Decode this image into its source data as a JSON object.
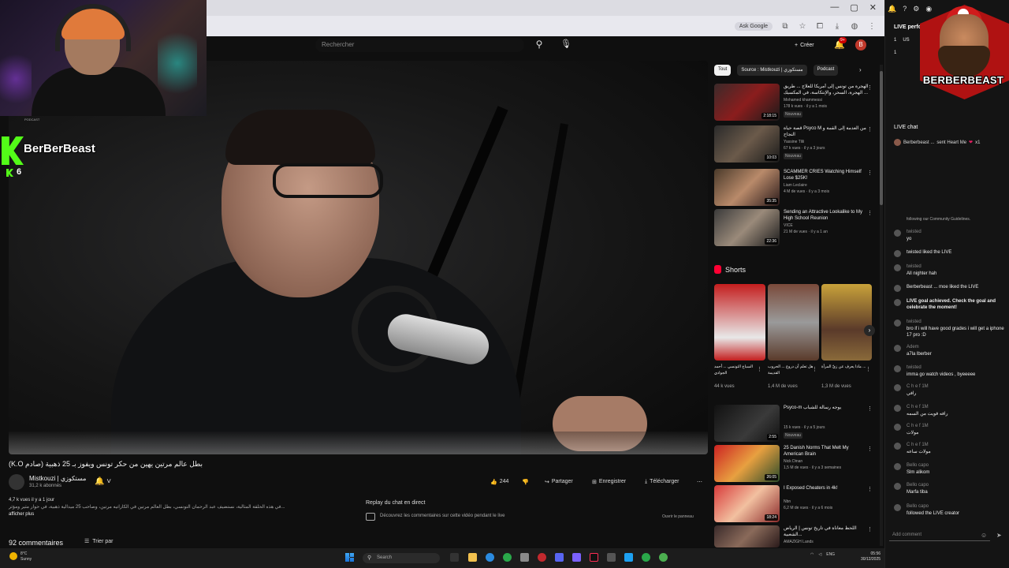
{
  "browser": {
    "ask_google": "Ask Google",
    "window_controls": [
      "—",
      "▢",
      "✕"
    ]
  },
  "yt_header": {
    "search_placeholder": "Rechercher",
    "create_label": "Créer",
    "notif_badge": "9+",
    "avatar_letter": "B"
  },
  "stream_overlay": {
    "tag": "PODCAST",
    "streamer": "BerBerBeast",
    "viewers": "6"
  },
  "video": {
    "title": "(K.O صادم) بطل عالم مرتين يهين من حكر تونس ويفوز بـ 25 ذهبية",
    "channel": "Mistkouzi | مستكوزي",
    "subscribers": "31,2 k abonnés",
    "likes": "244",
    "share": "Partager",
    "save": "Enregistrer",
    "download": "Télécharger",
    "description_meta": "4,7 k vues  il y a 1 jour",
    "description_line1": "في هذه الحلقة المثالية، نستضيف عبد الرحمان التونسي، بطل العالم مرتين في الكاراتيه مرتين، وصاحب 25 ميدالية ذهبية، في حوار مثير ومؤثر...",
    "show_more": "afficher plus",
    "chat_replay_title": "Replay du chat en direct",
    "chat_replay_text": "Découvrez les commentaires sur cette vidéo pendant le live",
    "chat_replay_open": "Ouvrir le panneau",
    "comments": "92 commentaires",
    "sort_by": "Trier par"
  },
  "filter_chips": [
    "Tout",
    "Source : Mistkouzi | مستكوزي",
    "Podcast"
  ],
  "recommendations": [
    {
      "title": "الهجرة من تونس إلى أمريكا للعلاج ... طريق الهجرة، السحر، والإنتكاسة، في المكسيك ...",
      "channel": "Mohamed khammessi",
      "views": "178 k vues · il y a 1 mois",
      "badge": "Nouveau",
      "duration": "2:18:15"
    },
    {
      "title": "قصة حياة Psyco M من العدمة إلى القمة و النجاح",
      "channel": "Yassine Tlili",
      "views": "67 k vues · il y a 3 jours",
      "badge": "Nouveau",
      "duration": "10:03"
    },
    {
      "title": "SCAMMER CRIES Watching Himself Lose $25K!",
      "channel": "Liam Leclaire",
      "views": "4 M de vues · il y a 3 mois",
      "badge": "",
      "duration": "35:35"
    },
    {
      "title": "Sending an Attractive Lookalike to My High School Reunion",
      "channel": "VICE",
      "views": "21 M de vues · il y a 1 an",
      "badge": "",
      "duration": "22:36"
    }
  ],
  "shorts": {
    "label": "Shorts",
    "items": [
      {
        "title": "السباح التونسي ... أحمد الجوادي",
        "views": "44 k vues"
      },
      {
        "title": "هل تعلم أن دروع ... الحروب القديمة",
        "views": "1,4 M de vues"
      },
      {
        "title": "ماذا يعرف عن زيّ المرأة ...",
        "views": "1,3 M de vues"
      }
    ]
  },
  "recommendations2": [
    {
      "title": "Psyco-m يوجه رسالة للشباب",
      "channel": "",
      "views": "15 k vues · il y a 5 jours",
      "badge": "Nouveau",
      "duration": "2:55"
    },
    {
      "title": "25 Danish Norms That Melt My American Brain",
      "channel": "Nick Dinan",
      "views": "1,5 M de vues · il y a 3 semaines",
      "badge": "",
      "duration": "26:05"
    },
    {
      "title": "I Exposed Cheaters in 4k!",
      "channel": "Nbn",
      "views": "6,2 M de vues · il y a 6 mois",
      "badge": "",
      "duration": "18:24"
    },
    {
      "title": "اللحظ معاناة في تاريخ تونس | الرياض الشعبية...",
      "channel": "AMAZIGH Lands",
      "views": "",
      "badge": "",
      "duration": ""
    }
  ],
  "taskbar": {
    "weather_temp": "8°C",
    "weather_desc": "Sunny",
    "search": "Search",
    "lang": "ENG",
    "time": "05:56",
    "date": "30/12/2025"
  },
  "live_panel": {
    "perf_title": "LIVE perform",
    "stat1": "1",
    "stat2": "US",
    "gift": "1",
    "overlay_name": "BERBERBEAST",
    "chat_title": "LIVE chat",
    "pinned_user": "Berberbeast ...",
    "pinned_text": "sent Heart Me",
    "pinned_count": "x1",
    "rules_tail": "following our Community Guidelines.",
    "input_placeholder": "Add comment"
  },
  "chat_messages": [
    {
      "user": "twisted",
      "text": "yo",
      "bold": false
    },
    {
      "user": "",
      "text": "twisted liked the LIVE",
      "bold": false,
      "inline": true
    },
    {
      "user": "twisted",
      "text": "All nighter hah",
      "bold": false
    },
    {
      "user": "",
      "text": "Berberbeast ... moe liked the LIVE",
      "bold": false,
      "inline": true
    },
    {
      "user": "",
      "text": "LIVE goal achieved. Check the goal and celebrate the moment!",
      "bold": true,
      "inline": true
    },
    {
      "user": "twisted",
      "text": "bro if i will have good grades i will get a iphone 17 pro :D",
      "bold": false
    },
    {
      "user": "Adem",
      "text": "a7la lberber",
      "bold": false
    },
    {
      "user": "twisted",
      "text": "imma go watch videos , byeeeee",
      "bold": false
    },
    {
      "user": "C h e f  1M",
      "text": "رافي",
      "bold": false
    },
    {
      "user": "C h e f  1M",
      "text": "رافه قويت من السمه",
      "bold": false
    },
    {
      "user": "C h e f  1M",
      "text": "مولات",
      "bold": false
    },
    {
      "user": "C h e f  1M",
      "text": "مولات ساعه",
      "bold": false
    },
    {
      "user": "Bello capo",
      "text": "Slm alikom",
      "bold": false
    },
    {
      "user": "Bello capo",
      "text": "Marfa tiba",
      "bold": false
    },
    {
      "user": "Bello capo",
      "text": "followed the LIVE creator",
      "bold": false
    }
  ]
}
